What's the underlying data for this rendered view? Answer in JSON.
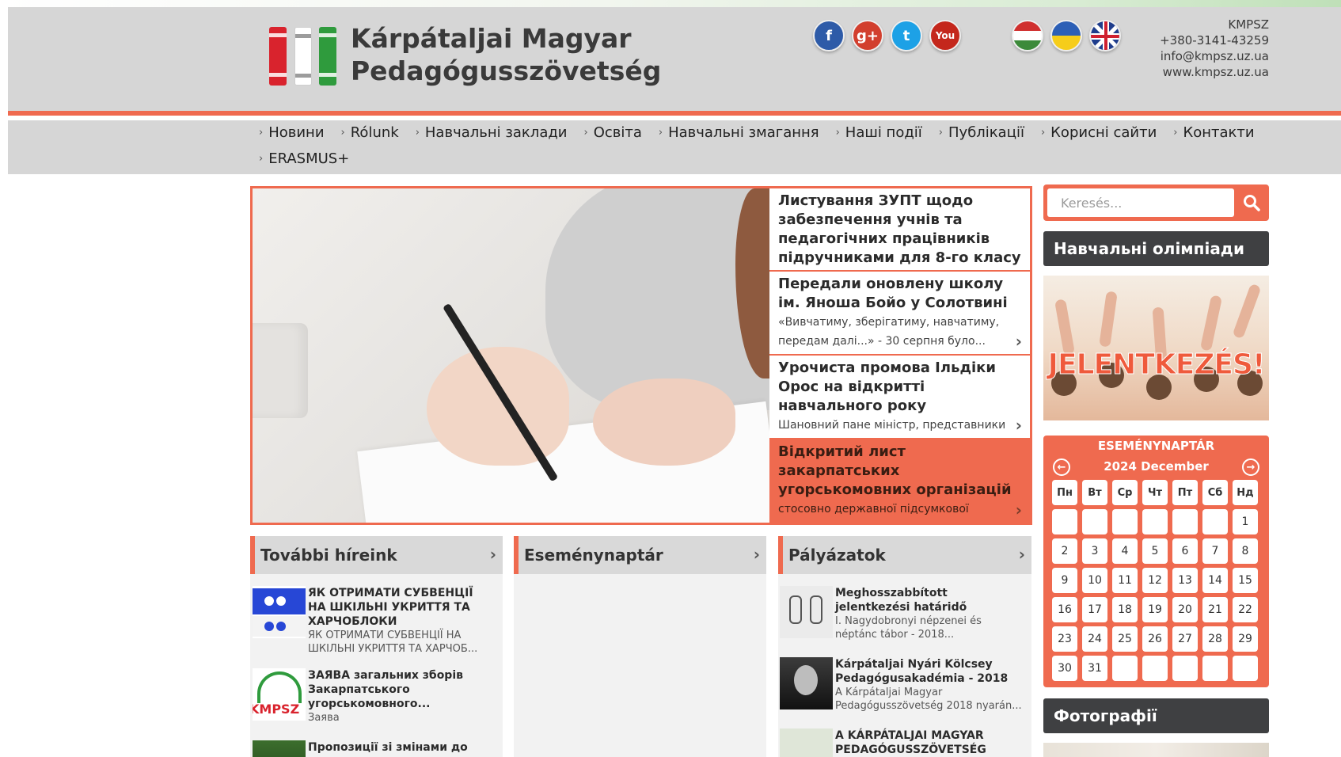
{
  "header": {
    "org_name_line1": "Kárpátaljai Magyar",
    "org_name_line2": "Pedagógusszövetség",
    "contact": {
      "abbr": "KMPSZ",
      "phone": "+380-3141-43259",
      "email": "info@kmpsz.uz.ua",
      "website": "www.kmpsz.uz.ua"
    },
    "social": [
      {
        "name": "facebook-icon",
        "glyph": "f"
      },
      {
        "name": "google-plus-icon",
        "glyph": "g+"
      },
      {
        "name": "twitter-icon",
        "glyph": "t"
      },
      {
        "name": "youtube-icon",
        "glyph": "You"
      }
    ],
    "flags": [
      "hungarian-flag-icon",
      "ukrainian-flag-icon",
      "uk-flag-icon"
    ]
  },
  "nav": {
    "row1": [
      "Новини",
      "Rólunk",
      "Навчальні заклади",
      "Освіта",
      "Навчальні змагання",
      "Наші події",
      "Публікації",
      "Корисні сайти",
      "Контакти"
    ],
    "row2": [
      "ERASMUS+"
    ]
  },
  "slider": {
    "items": [
      {
        "title": "Листування ЗУПТ щодо забезпечення учнів та педагогічних працівників підручниками для 8-го класу",
        "desc": ""
      },
      {
        "title": "Передали оновлену школу ім. Яноша Бойо у Солотвині",
        "desc": "«Вивчатиму, зберігатиму, навчатиму, передам далі...» - 30 серпня було..."
      },
      {
        "title": "Урочиста промова Ільдіки Орос на відкритті навчального року",
        "desc": "Шановний пане міністр, представники конфесій та світські персони!"
      },
      {
        "title": "Відкритий лист закарпатських угорськомовних організацій",
        "desc": "стосовно державної підсумкової атестації учнів закладів середньої освіти..."
      }
    ]
  },
  "columns": {
    "news": {
      "heading": "További híreink",
      "items": [
        {
          "title": "ЯК ОТРИМАТИ СУБВЕНЦІЇ НА ШКІЛЬНІ УКРИТТЯ ТА ХАРЧОБЛОКИ",
          "sub": "ЯК ОТРИМАТИ СУБВЕНЦІЇ НА ШКІЛЬНІ УКРИТТЯ ТА ХАРЧОБ..."
        },
        {
          "title": "ЗАЯВА загальних зборів Закарпатського угорськомовного...",
          "sub": "Заява"
        },
        {
          "title": "Пропозиції зі змінами до",
          "sub": ""
        }
      ]
    },
    "events": {
      "heading": "Eseménynaptár"
    },
    "tenders": {
      "heading": "Pályázatok",
      "items": [
        {
          "title": "Meghosszabbított jelentkezési határidő",
          "sub": "I. Nagydobronyi népzenei és néptánc tábor - 2018..."
        },
        {
          "title": "Kárpátaljai Nyári Kölcsey Pedagógusakadémia - 2018",
          "sub": "A Kárpátaljai Magyar Pedagógusszövetség 2018 nyarán..."
        },
        {
          "title": "A KÁRPÁTALJAI MAGYAR PEDAGÓGUSSZÖVETSÉG NYÁRI",
          "sub": ""
        }
      ]
    }
  },
  "sidebar": {
    "search_placeholder": "Keresés...",
    "olympiad_heading": "Навчальні олімпіади",
    "banner_text": "JELENTKEZÉS!",
    "photos_heading": "Фотографії",
    "calendar": {
      "title": "ESEMÉNYNAPTÁR",
      "month": "2024 December",
      "days_of_week": [
        "Пн",
        "Вт",
        "Ср",
        "Чт",
        "Пт",
        "Сб",
        "Нд"
      ],
      "cells": [
        "",
        "",
        "",
        "",
        "",
        "",
        "1",
        "2",
        "3",
        "4",
        "5",
        "6",
        "7",
        "8",
        "9",
        "10",
        "11",
        "12",
        "13",
        "14",
        "15",
        "16",
        "17",
        "18",
        "19",
        "20",
        "21",
        "22",
        "23",
        "24",
        "25",
        "26",
        "27",
        "28",
        "29",
        "30",
        "31",
        "",
        "",
        "",
        "",
        ""
      ]
    }
  },
  "colors": {
    "accent": "#ef6a4f",
    "header_bg": "#d6d6d6",
    "dark_heading": "#3f4042"
  }
}
